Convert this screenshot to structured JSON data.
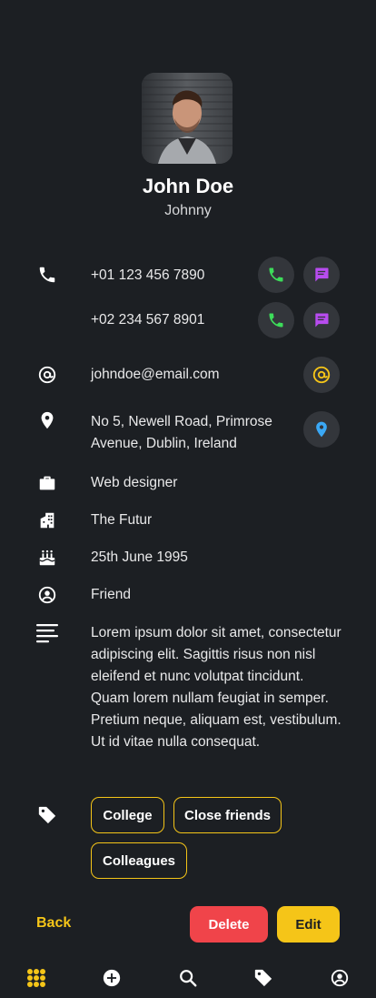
{
  "profile": {
    "name": "John Doe",
    "nickname": "Johnny"
  },
  "phones": [
    {
      "number": "+01 123 456 7890"
    },
    {
      "number": "+02 234 567 8901"
    }
  ],
  "email": "johndoe@email.com",
  "address": {
    "line1": "No 5, Newell Road, Primrose",
    "line2": "Avenue, Dublin, Ireland"
  },
  "job_title": "Web designer",
  "company": "The Futur",
  "birthday": "25th June 1995",
  "relationship": "Friend",
  "notes": "Lorem ipsum dolor sit amet, consectetur adipiscing elit. Sagittis risus non nisl eleifend et nunc volutpat tincidunt. Quam lorem nullam feugiat in semper. Pretium neque, aliquam est, vestibulum. Ut id vitae nulla consequat.",
  "tags": [
    "College",
    "Close friends",
    "Colleagues"
  ],
  "actions": {
    "back": "Back",
    "delete": "Delete",
    "edit": "Edit"
  },
  "colors": {
    "background": "#1c1f23",
    "accent": "#f5c518",
    "call_green": "#3ddc5a",
    "message_purple": "#b84cf0",
    "location_blue": "#3aa8f5",
    "delete_red": "#f0444a"
  },
  "nav": [
    "apps-grid-icon",
    "add-icon",
    "search-icon",
    "tag-icon",
    "profile-icon"
  ]
}
